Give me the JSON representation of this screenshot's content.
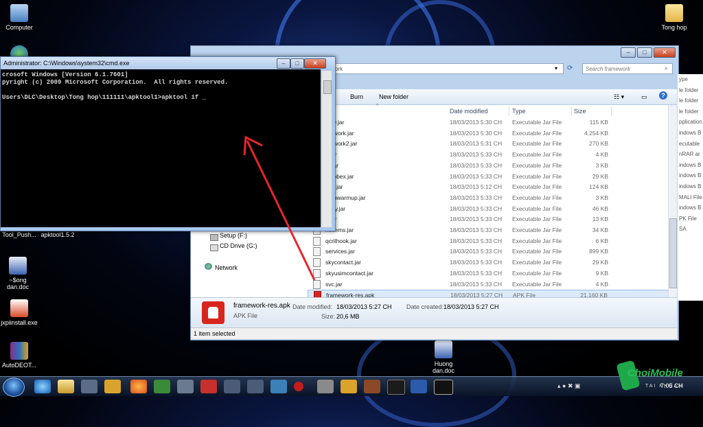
{
  "desktop": {
    "icons": [
      {
        "label": "Computer"
      },
      {
        "label": "Tong hop"
      },
      {
        "label": "Tool_Push..."
      },
      {
        "label": "apktool1.5.2"
      },
      {
        "label": "~$ong dan.doc"
      },
      {
        "label": "jxpiinstall.exe"
      },
      {
        "label": "AutoDEOT..."
      },
      {
        "label": "Huong dan.doc"
      }
    ]
  },
  "cmd": {
    "title": "Administrator: C:\\Windows\\system32\\cmd.exe",
    "lines": [
      "crosoft Windows [Version 6.1.7601]",
      "pyright (c) 2009 Microsoft Corporation.  All rights reserved.",
      "",
      "Users\\DLC\\Desktop\\Tong hop\\111111\\apktool1>apktool if _"
    ]
  },
  "explorer": {
    "address_text": "ork",
    "search_placeholder": "Search framework",
    "toolbar": {
      "burn": "Burn",
      "new_folder": "New folder"
    },
    "nav": {
      "setup": "Setup (F:)",
      "cd_drive": "CD Drive (G:)",
      "network": "Network"
    },
    "columns": {
      "date": "Date modified",
      "type": "Type",
      "size": "Size"
    },
    "files": [
      {
        "name": "ertw.jar",
        "date": "18/03/2013 5:30 CH",
        "type": "Executable Jar File",
        "size": "115 KB"
      },
      {
        "name": "mework.jar",
        "date": "18/03/2013 5:30 CH",
        "type": "Executable Jar File",
        "size": "4.254 KB"
      },
      {
        "name": "mework2.jar",
        "date": "18/03/2013 5:31 CH",
        "type": "Executable Jar File",
        "size": "270 KB"
      },
      {
        "name": "e.jar",
        "date": "18/03/2013 5:33 CH",
        "type": "Executable Jar File",
        "size": "4 KB"
      },
      {
        "name": "ut.jar",
        "date": "18/03/2013 5:33 CH",
        "type": "Executable Jar File",
        "size": "3 KB"
      },
      {
        "name": "ax.obex.jar",
        "date": "18/03/2013 5:33 CH",
        "type": "Executable Jar File",
        "size": "29 KB"
      },
      {
        "name": "dex.jar",
        "date": "18/03/2013 5:12 CH",
        "type": "Executable Jar File",
        "size": "124 KB"
      },
      {
        "name": "demwarmup.jar",
        "date": "18/03/2013 5:33 CH",
        "type": "Executable Jar File",
        "size": "3 KB"
      },
      {
        "name": "nkey.jar",
        "date": "18/03/2013 5:33 CH",
        "type": "Executable Jar File",
        "size": "46 KB"
      },
      {
        "name": "a.jar",
        "date": "18/03/2013 5:33 CH",
        "type": "Executable Jar File",
        "size": "13 KB"
      },
      {
        "name": "nvitems.jar",
        "date": "18/03/2013 5:33 CH",
        "type": "Executable Jar File",
        "size": "34 KB"
      },
      {
        "name": "qcrilhook.jar",
        "date": "18/03/2013 5:33 CH",
        "type": "Executable Jar File",
        "size": "6 KB"
      },
      {
        "name": "services.jar",
        "date": "18/03/2013 5:33 CH",
        "type": "Executable Jar File",
        "size": "899 KB"
      },
      {
        "name": "skycontact.jar",
        "date": "18/03/2013 5:33 CH",
        "type": "Executable Jar File",
        "size": "29 KB"
      },
      {
        "name": "skyusimcontact.jar",
        "date": "18/03/2013 5:33 CH",
        "type": "Executable Jar File",
        "size": "9 KB"
      },
      {
        "name": "svc.jar",
        "date": "18/03/2013 5:33 CH",
        "type": "Executable Jar File",
        "size": "4 KB"
      },
      {
        "name": "framework-res.apk",
        "date": "18/03/2013 5:27 CH",
        "type": "APK File",
        "size": "21.160 KB"
      }
    ],
    "details": {
      "filename": "framework-res.apk",
      "filetype": "APK File",
      "date_modified_label": "Date modified:",
      "date_modified": "18/03/2013 5:27 CH",
      "date_created_label": "Date created:",
      "date_created": "18/03/2013 5:27 CH",
      "size_label": "Size:",
      "size": "20,6 MB"
    },
    "status": "1 item selected"
  },
  "right_strip": [
    "ype",
    "le folder",
    "le folder",
    "le folder",
    "pplication",
    "indows B",
    "ecutable",
    "nRAR ar",
    "indows B",
    "indows B",
    "indows B",
    "MALI File",
    "indows B",
    "PK File",
    "SA"
  ],
  "taskbar": {
    "time": "7:05 CH"
  },
  "watermark": {
    "brand": "ChoiMobile",
    "tagline": "TAI KHOAN"
  },
  "colors": {
    "selection": "#dbe9f9",
    "arrow": "#e8262a",
    "cmd_bg": "#000000"
  }
}
